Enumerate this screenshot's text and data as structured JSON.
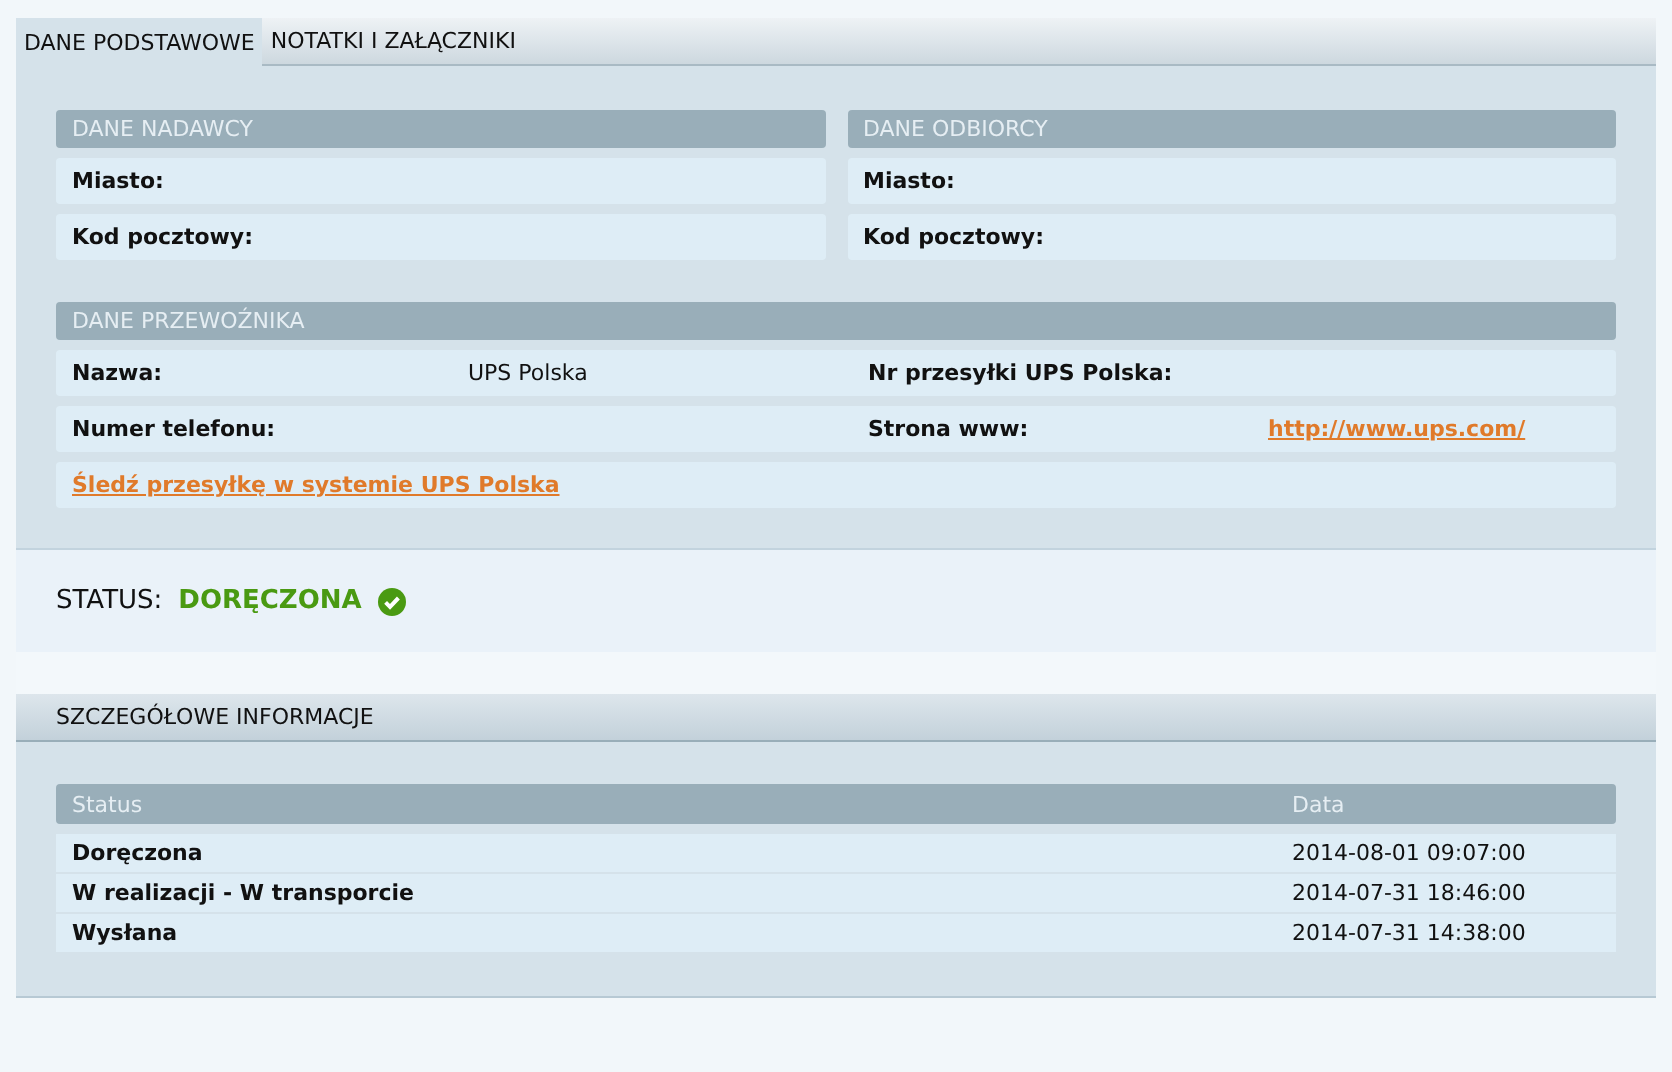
{
  "tabs": [
    {
      "label": "DANE PODSTAWOWE",
      "selected": true
    },
    {
      "label": "NOTATKI I ZAŁĄCZNIKI",
      "selected": false
    }
  ],
  "sender": {
    "title": "DANE NADAWCY",
    "fields": [
      {
        "label": "Miasto:"
      },
      {
        "label": "Kod pocztowy:"
      }
    ]
  },
  "recipient": {
    "title": "DANE ODBIORCY",
    "fields": [
      {
        "label": "Miasto:"
      },
      {
        "label": "Kod pocztowy:"
      }
    ]
  },
  "carrier": {
    "title": "DANE PRZEWOŹNIKA",
    "rows": [
      {
        "label": "Nazwa:",
        "value": "UPS Polska",
        "label2": "Nr przesyłki UPS Polska:"
      },
      {
        "label": "Numer telefonu:",
        "label2": "Strona www:",
        "link2": "http://www.ups.com/"
      }
    ],
    "track_link": "Śledź przesyłkę w systemie UPS Polska"
  },
  "status": {
    "label": "STATUS:",
    "value": "DORĘCZONA",
    "delivered": true
  },
  "details": {
    "title": "SZCZEGÓŁOWE INFORMACJE",
    "columns": [
      "Status",
      "Data"
    ],
    "rows": [
      [
        "Doręczona",
        "2014-08-01 09:07:00"
      ],
      [
        "W realizacji - W transporcie",
        "2014-07-31 18:46:00"
      ],
      [
        "Wysłana",
        "2014-07-31 14:38:00"
      ]
    ]
  }
}
